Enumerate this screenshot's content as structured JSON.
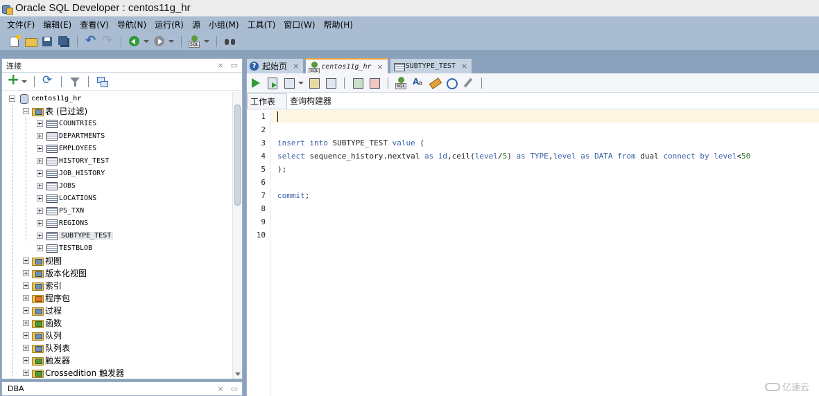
{
  "window": {
    "title": "Oracle SQL Developer : centos11g_hr"
  },
  "menu": [
    "文件(F)",
    "编辑(E)",
    "查看(V)",
    "导航(N)",
    "运行(R)",
    "源",
    "小组(M)",
    "工具(T)",
    "窗口(W)",
    "帮助(H)"
  ],
  "toolbar": {
    "icons": [
      "new-icon",
      "open-icon",
      "save-icon",
      "save-all-icon",
      "undo-icon",
      "redo-icon",
      "back-icon",
      "forward-icon",
      "sql-worksheet-icon",
      "find-db-object-icon"
    ]
  },
  "connections_panel": {
    "title": "连接",
    "close_glyph": "×",
    "minimize_glyph": "▭",
    "tree": {
      "connection": "centos11g_hr",
      "tables_folder": "表 (已过滤)",
      "tables": [
        "COUNTRIES",
        "DEPARTMENTS",
        "EMPLOYEES",
        "HISTORY_TEST",
        "JOB_HISTORY",
        "JOBS",
        "LOCATIONS",
        "PS_TXN",
        "REGIONS",
        "SUBTYPE_TEST",
        "TESTBLOB"
      ],
      "selected_table": "SUBTYPE_TEST",
      "folders": [
        "视图",
        "版本化视图",
        "索引",
        "程序包",
        "过程",
        "函数",
        "队列",
        "队列表",
        "触发器",
        "Crossedition 触发器"
      ]
    }
  },
  "dba_panel": {
    "title": "DBA",
    "close_glyph": "×",
    "minimize_glyph": "▭"
  },
  "editor": {
    "tabs": [
      {
        "label": "起始页",
        "icon": "help-icon",
        "close": "×"
      },
      {
        "label": "centos11g_hr",
        "icon": "sql-worksheet-icon",
        "close": "×",
        "active": true
      },
      {
        "label": "SUBTYPE_TEST",
        "icon": "table-icon",
        "close": "×"
      }
    ],
    "toolbar_icons": [
      "run-statement-icon",
      "run-script-icon",
      "autotrace-icon",
      "explain-plan-icon",
      "sql-tuning-icon",
      "commit-icon",
      "rollback-icon",
      "sql-history-icon",
      "to-upper-lower-icon",
      "clear-icon",
      "history-icon",
      "format-icon"
    ],
    "sub_tabs": [
      "工作表",
      "查询构建器"
    ],
    "active_sub_tab": "工作表",
    "line_numbers": [
      "1",
      "2",
      "3",
      "4",
      "5",
      "6",
      "7",
      "8",
      "9",
      "10"
    ],
    "code": {
      "line3": {
        "kw1": "insert into",
        "t1": " SUBTYPE_TEST ",
        "kw2": "value",
        "t2": " ("
      },
      "line4": {
        "kw1": "select",
        "t1": " sequence_history.nextval ",
        "kw2": "as",
        "t2": " ",
        "kw3": "id",
        "t3": ",ceil(",
        "kw4": "level",
        "t4": "/",
        "n1": "5",
        "t5": ") ",
        "kw5": "as",
        "t6": " ",
        "kw6": "TYPE",
        "t7": ",",
        "kw7": "level",
        "t8": " ",
        "kw8": "as",
        "t9": " ",
        "kw9": "DATA",
        "t10": " ",
        "kw10": "from",
        "t11": " dual ",
        "kw11": "connect by",
        "t12": " ",
        "kw12": "level",
        "t13": "<",
        "n2": "50"
      },
      "line5": ");",
      "line7": {
        "kw1": "commit",
        "t1": ";"
      }
    }
  },
  "watermark": "亿速云"
}
